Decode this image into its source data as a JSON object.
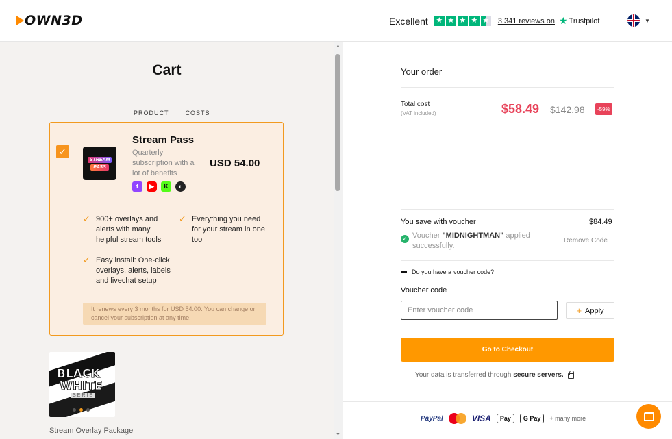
{
  "header": {
    "brand": "OWN3D",
    "trust_label": "Excellent",
    "reviews_link": "3.341 reviews on",
    "trustpilot": "Trustpilot",
    "rating_stars": 4.5,
    "language_flag": "uk-flag-icon"
  },
  "cart": {
    "title": "Cart",
    "col_product": "PRODUCT",
    "col_costs": "COSTS",
    "item": {
      "name": "Stream Pass",
      "thumb_line1": "STREAM",
      "thumb_line2": "PASS",
      "description": "Quarterly subscription with a lot of benefits",
      "price": "USD 54.00",
      "platforms": [
        "twitch-icon",
        "youtube-icon",
        "kick-icon",
        "obs-icon"
      ],
      "features": [
        "900+ overlays and alerts with many helpful stream tools",
        "Everything you need for your stream in one tool",
        "Easy install: One-click overlays, alerts, labels and livechat setup"
      ],
      "renew_note": "It renews every 3 months for USD 54.00. You can change or cancel your subscription at any time."
    },
    "package": {
      "img_line1": "BLACK",
      "img_line2": "WHITE",
      "img_line3": "SERIE",
      "label": "Stream Overlay Package"
    }
  },
  "order": {
    "title": "Your order",
    "total_label": "Total cost",
    "vat_note": "(VAT included)",
    "price_new": "$58.49",
    "price_old": "$142.98",
    "discount": "-59%",
    "save_label": "You save with voucher",
    "save_value": "$84.49",
    "voucher_prefix": "Voucher",
    "voucher_code": "\"MIDNIGHTMAN\"",
    "voucher_suffix": "applied successfully.",
    "remove_code": "Remove Code",
    "have_voucher": "Do you have a",
    "have_voucher_link": "voucher code?",
    "voucher_label": "Voucher code",
    "voucher_placeholder": "Enter voucher code",
    "apply": "Apply",
    "checkout": "Go to Checkout",
    "secure_prefix": "Your data is transferred through",
    "secure_bold": "secure servers.",
    "payments": [
      "PayPal",
      "VISA",
      "Pay",
      "G Pay",
      "+ many more"
    ]
  },
  "colors": {
    "accent": "#ff9800",
    "sale_red": "#e8435a",
    "success": "#26b36b",
    "trustpilot": "#00b67a"
  }
}
